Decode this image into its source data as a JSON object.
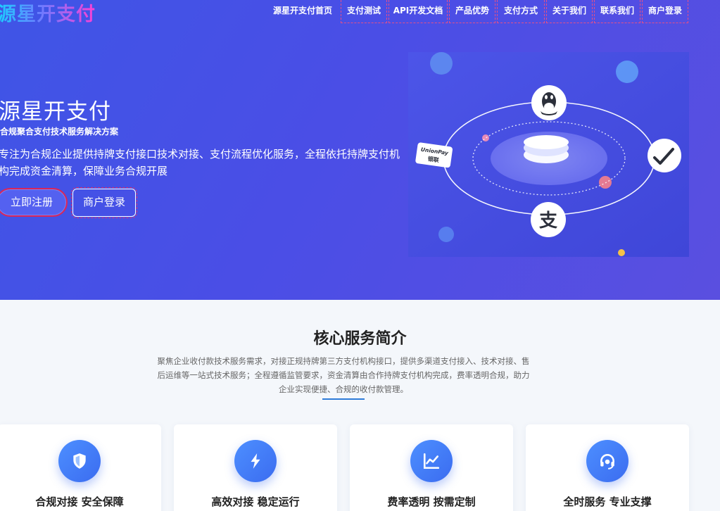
{
  "brand": {
    "logo_text": "源星开支付"
  },
  "nav": {
    "items": [
      {
        "label": "源星开支付首页"
      },
      {
        "label": "支付测试"
      },
      {
        "label": "API开发文档"
      },
      {
        "label": "产品优势"
      },
      {
        "label": "支付方式"
      },
      {
        "label": "关于我们"
      },
      {
        "label": "联系我们"
      },
      {
        "label": "商户登录"
      }
    ]
  },
  "hero": {
    "title": "源星开支付",
    "subtitle": "合规聚合支付技术服务解决方案",
    "description": "专注为合规企业提供持牌支付接口技术对接、支付流程优化服务，全程依托持牌支付机构完成资金清算，保障业务合规开展",
    "register_button": "立即注册",
    "login_button": "商户登录",
    "illustration": {
      "card_text_top": "UnionPay",
      "card_text_bottom": "银联",
      "icons": [
        "qq-icon",
        "wechat-icon",
        "alipay-icon",
        "unionpay-card-icon"
      ]
    }
  },
  "service": {
    "title": "核心服务简介",
    "description": "聚焦企业收付款技术服务需求，对接正规持牌第三方支付机构接口，提供多渠道支付接入、技术对接、售后运维等一站式技术服务；全程遵循监管要求，资金清算由合作持牌支付机构完成，费率透明合规，助力企业实现便捷、合规的收付款管理。",
    "cards": [
      {
        "icon": "shield-icon",
        "title": "合规对接 安全保障"
      },
      {
        "icon": "lightning-icon",
        "title": "高效对接 稳定运行"
      },
      {
        "icon": "chart-line-icon",
        "title": "费率透明 按需定制"
      },
      {
        "icon": "headset-icon",
        "title": "全时服务 专业支撑"
      }
    ]
  },
  "colors": {
    "hero_start": "#3f55e6",
    "hero_end": "#5a4fe0",
    "accent_blue": "#3b6cf0",
    "highlight_red": "#d9265a"
  }
}
